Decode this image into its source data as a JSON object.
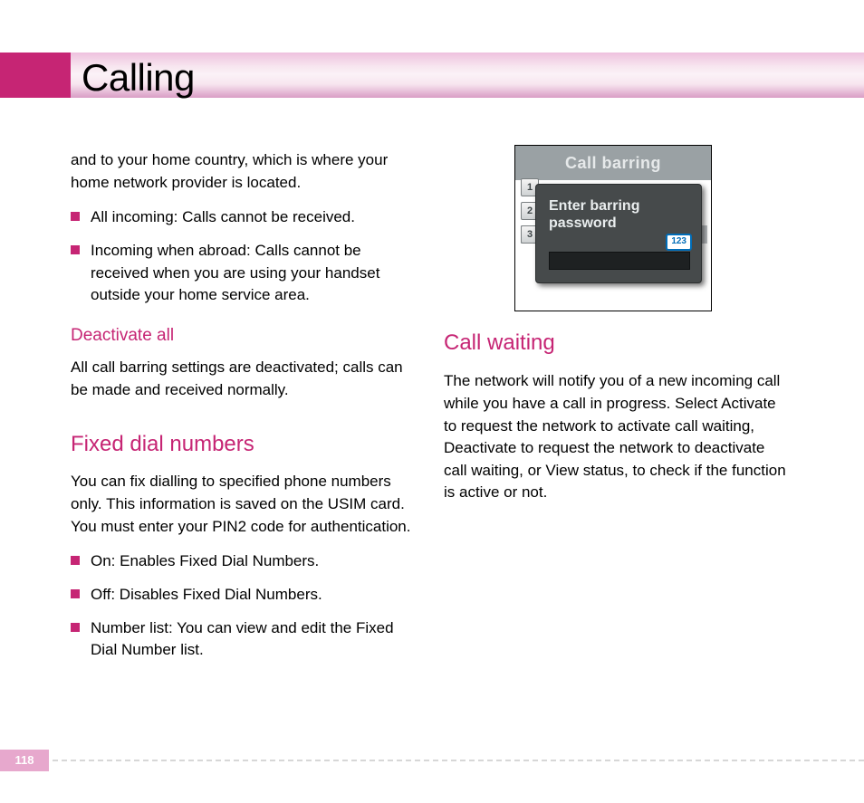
{
  "header": {
    "title": "Calling"
  },
  "left": {
    "intro": "and to your home country, which is where your home network provider is located.",
    "bullets_top": [
      "All incoming: Calls cannot be received.",
      "Incoming when abroad: Calls cannot be received when you are using your handset outside your home service area."
    ],
    "deactivate": {
      "heading": "Deactivate all",
      "body": "All call barring settings are deactivated; calls can be made and received normally."
    },
    "fixed": {
      "heading": "Fixed dial numbers",
      "body": "You can fix dialling to specified phone numbers only. This information is saved on the USIM card. You must enter your PIN2 code for authentication.",
      "bullets": [
        "On: Enables Fixed Dial Numbers.",
        "Off: Disables Fixed Dial Numbers.",
        "Number list: You can view and edit the Fixed Dial Number list."
      ]
    }
  },
  "right": {
    "screenshot": {
      "title": "Call barring",
      "row1": "1",
      "row2": "2",
      "row3": "3",
      "dialog_line1": "Enter barring",
      "dialog_line2": "password",
      "mode_badge": "123"
    },
    "call_waiting": {
      "heading": "Call waiting",
      "body": "The network will notify you of a new incoming call while you have a call in progress. Select Activate to request the network to activate call waiting, Deactivate to request the network to deactivate call waiting, or View status, to check if the function is active or not."
    }
  },
  "page_number": "118"
}
